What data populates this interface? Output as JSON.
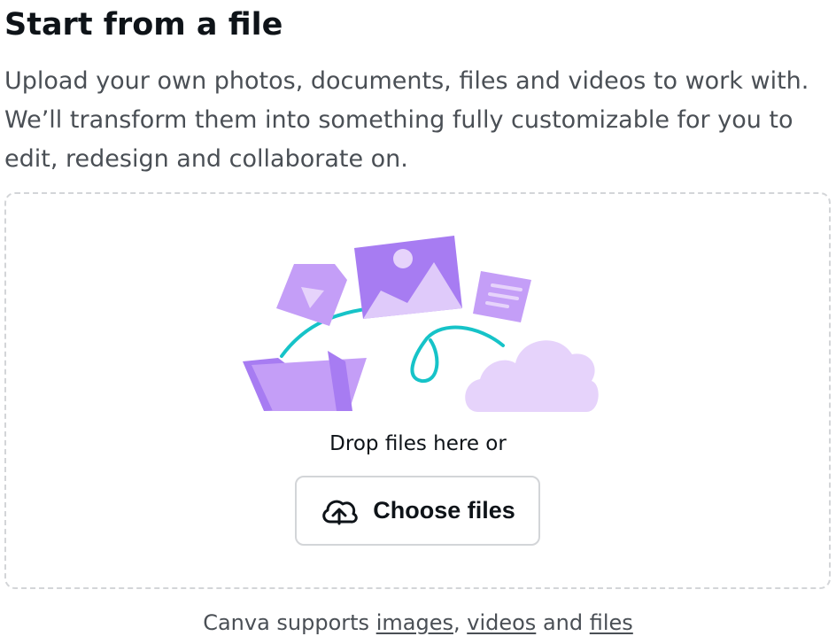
{
  "header": {
    "title": "Start from a file",
    "description": "Upload your own photos, documents, files and videos to work with. We’ll transform them into something fully customizable for you to edit, redesign and collaborate on."
  },
  "dropzone": {
    "illustration_icons": [
      "video-file-icon",
      "image-file-icon",
      "document-file-icon",
      "folder-icon",
      "cloud-icon"
    ],
    "prompt": "Drop files here or",
    "choose_button": {
      "label": "Choose files",
      "icon": "cloud-upload-icon"
    }
  },
  "footer": {
    "prefix": "Canva supports",
    "link_images": "images",
    "separator": ",",
    "link_videos": "videos",
    "conjunction": "and",
    "link_files": "files"
  },
  "colors": {
    "text_primary": "#0e1318",
    "text_secondary": "#4a4f55",
    "border": "#d3d5d8",
    "purple_dark": "#a77cf2",
    "purple_medium": "#c49ef7",
    "purple_light": "#e6d3fb",
    "teal_accent": "#16c3c8"
  }
}
